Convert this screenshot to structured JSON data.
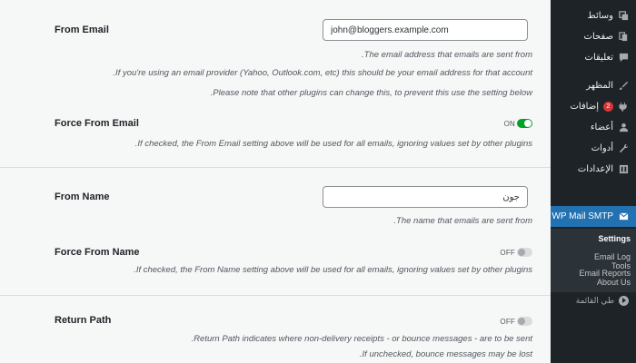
{
  "settings": {
    "from_email": {
      "label": "From Email",
      "value": "john@bloggers.example.com",
      "desc1": ".The email address that emails are sent from",
      "desc2": ".If you're using an email provider (Yahoo, Outlook.com, etc) this should be your email address for that account",
      "desc3": ".Please note that other plugins can change this, to prevent this use the setting below"
    },
    "force_from_email": {
      "label": "Force From Email",
      "state": "ON",
      "desc": ".If checked, the From Email setting above will be used for all emails, ignoring values set by other plugins"
    },
    "from_name": {
      "label": "From Name",
      "value": "جون",
      "desc": ".The name that emails are sent from"
    },
    "force_from_name": {
      "label": "Force From Name",
      "state": "OFF",
      "desc": ".If checked, the From Name setting above will be used for all emails, ignoring values set by other plugins"
    },
    "return_path": {
      "label": "Return Path",
      "state": "OFF",
      "desc1": ".Return Path indicates where non-delivery receipts - or bounce messages - are to be sent",
      "desc2": ".If unchecked, bounce messages may be lost"
    }
  },
  "sidebar": {
    "items": [
      {
        "label": "وسائط",
        "icon": "media-icon"
      },
      {
        "label": "صفحات",
        "icon": "pages-icon"
      },
      {
        "label": "تعليقات",
        "icon": "comments-icon"
      },
      {
        "label": "المظهر",
        "icon": "appearance-icon"
      },
      {
        "label": "إضافات",
        "icon": "plugins-icon",
        "badge": "2"
      },
      {
        "label": "أعضاء",
        "icon": "users-icon"
      },
      {
        "label": "أدوات",
        "icon": "tools-icon"
      },
      {
        "label": "الإعدادات",
        "icon": "settings-icon"
      },
      {
        "label": "WP Mail SMTP",
        "icon": "mail-icon"
      }
    ],
    "submenu": [
      "Settings",
      "Email Log",
      "Email Reports",
      "Tools",
      "About Us"
    ],
    "collapse_label": "طي القائمة"
  },
  "colors": {
    "sidebar_bg": "#1d2327",
    "active_bg": "#2271b1",
    "toggle_on": "#00a32a",
    "badge": "#d63638"
  }
}
